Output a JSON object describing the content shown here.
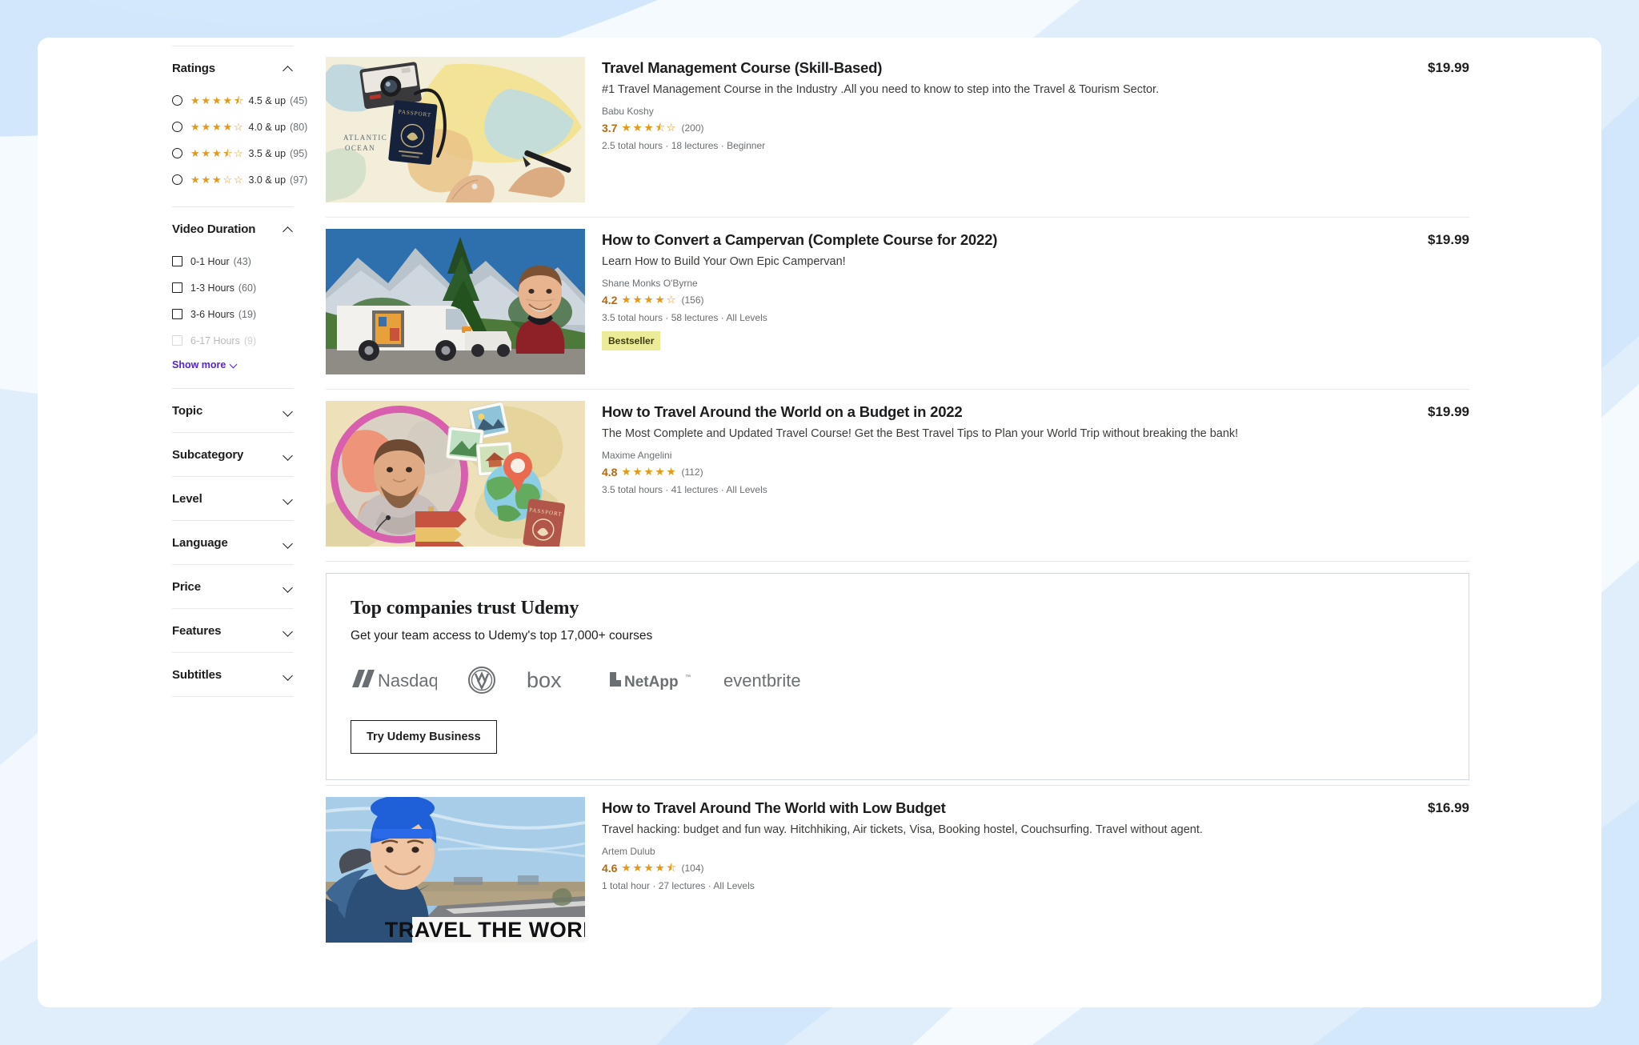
{
  "sidebar": {
    "groups": [
      {
        "name": "ratings",
        "title": "Ratings",
        "expanded": true,
        "control": "radio",
        "options": [
          {
            "stars": 4.5,
            "label": "4.5 & up",
            "count": "(45)",
            "faded": false
          },
          {
            "stars": 4.0,
            "label": "4.0 & up",
            "count": "(80)",
            "faded": false
          },
          {
            "stars": 3.5,
            "label": "3.5 & up",
            "count": "(95)",
            "faded": false
          },
          {
            "stars": 3.0,
            "label": "3.0 & up",
            "count": "(97)",
            "faded": false
          }
        ]
      },
      {
        "name": "video-duration",
        "title": "Video Duration",
        "expanded": true,
        "control": "checkbox",
        "options": [
          {
            "label": "0-1 Hour",
            "count": "(43)",
            "faded": false
          },
          {
            "label": "1-3 Hours",
            "count": "(60)",
            "faded": false
          },
          {
            "label": "3-6 Hours",
            "count": "(19)",
            "faded": false
          },
          {
            "label": "6-17 Hours",
            "count": "(9)",
            "faded": true
          }
        ],
        "show_more_label": "Show more"
      },
      {
        "name": "topic",
        "title": "Topic",
        "expanded": false
      },
      {
        "name": "subcategory",
        "title": "Subcategory",
        "expanded": false
      },
      {
        "name": "level",
        "title": "Level",
        "expanded": false
      },
      {
        "name": "language",
        "title": "Language",
        "expanded": false
      },
      {
        "name": "price",
        "title": "Price",
        "expanded": false
      },
      {
        "name": "features",
        "title": "Features",
        "expanded": false
      },
      {
        "name": "subtitles",
        "title": "Subtitles",
        "expanded": false
      }
    ]
  },
  "courses": [
    {
      "title": "Travel Management Course (Skill-Based)",
      "description": "#1 Travel Management Course in the Industry .All you need to know to step into the Travel & Tourism Sector.",
      "instructor": "Babu Koshy",
      "rating": "3.7",
      "rating_count": "(200)",
      "stars": 3.5,
      "meta": "2.5 total hours · 18 lectures · Beginner",
      "price": "$19.99",
      "badge": null,
      "thumb": "map-camera-passport"
    },
    {
      "title": "How to Convert a Campervan (Complete Course for 2022)",
      "description": "Learn How to Build Your Own Epic Campervan!",
      "instructor": "Shane Monks O'Byrne",
      "rating": "4.2",
      "rating_count": "(156)",
      "stars": 4.0,
      "meta": "3.5 total hours · 58 lectures · All Levels",
      "price": "$19.99",
      "badge": "Bestseller",
      "thumb": "campervan-mountains"
    },
    {
      "title": "How to Travel Around the World on a Budget in 2022",
      "description": "The Most Complete and Updated Travel Course! Get the Best Travel Tips to Plan your World Trip without breaking the bank!",
      "instructor": "Maxime Angelini",
      "rating": "4.8",
      "rating_count": "(112)",
      "stars": 5.0,
      "meta": "3.5 total hours · 41 lectures · All Levels",
      "price": "$19.99",
      "badge": null,
      "thumb": "globe-portrait-pink"
    },
    {
      "title": "How to Travel Around The World with Low Budget",
      "description": "Travel hacking: budget and fun way. Hitchhiking, Air tickets, Visa, Booking hostel, Couchsurfing. Travel without agent.",
      "instructor": "Artem Dulub",
      "rating": "4.6",
      "rating_count": "(104)",
      "stars": 4.5,
      "meta": "1 total hour · 27 lectures · All Levels",
      "price": "$16.99",
      "badge": null,
      "thumb": "roadside-selfie",
      "thumb_overlay_text": "TRAVEL THE WORLD"
    }
  ],
  "business_banner": {
    "title": "Top companies trust Udemy",
    "subtitle": "Get your team access to Udemy's top 17,000+ courses",
    "logos": [
      "Nasdaq",
      "Volkswagen",
      "box",
      "NetApp",
      "eventbrite"
    ],
    "button_label": "Try Udemy Business"
  },
  "colors": {
    "accent_purple": "#5624d0",
    "star_orange": "#e59819",
    "rating_text": "#b4690e",
    "badge_bg": "#eceb98",
    "text_primary": "#1c1d1f",
    "text_muted": "#6a6f73",
    "background_blue": "#e3f0fc"
  }
}
